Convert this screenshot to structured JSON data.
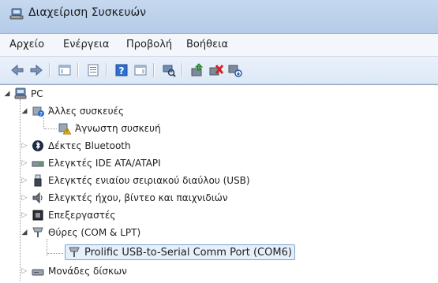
{
  "window": {
    "title": "Διαχείριση Συσκευών"
  },
  "menu": [
    "Αρχείο",
    "Ενέργεια",
    "Προβολή",
    "Βοήθεια"
  ],
  "toolbar": {
    "buttons": [
      "back-icon",
      "forward-icon",
      "show-hide-console-tree-icon",
      "properties-icon",
      "help-icon",
      "action-pane-icon",
      "scan-hardware-icon",
      "update-driver-icon",
      "uninstall-device-icon",
      "disable-device-icon"
    ]
  },
  "tree": {
    "root": "PC",
    "items": [
      {
        "label": "Άλλες συσκευές",
        "icon": "unknown-device-category-icon"
      },
      {
        "label": "Άγνωστη συσκευή",
        "icon": "warning-device-icon"
      },
      {
        "label": "Δέκτες Bluetooth",
        "icon": "bluetooth-icon"
      },
      {
        "label": "Ελεγκτές IDE ATA/ATAPI",
        "icon": "ide-controller-icon"
      },
      {
        "label": "Ελεγκτές ενιαίου σειριακού διαύλου (USB)",
        "icon": "usb-icon"
      },
      {
        "label": "Ελεγκτές ήχου, βίντεο και παιχνιδιών",
        "icon": "speaker-icon"
      },
      {
        "label": "Επεξεργαστές",
        "icon": "processor-icon"
      },
      {
        "label": "Θύρες (COM & LPT)",
        "icon": "port-icon"
      },
      {
        "label": "Prolific USB-to-Serial Comm Port (COM6)",
        "icon": "port-icon"
      },
      {
        "label": "Μονάδες δίσκων",
        "icon": "disk-drive-icon"
      }
    ]
  }
}
